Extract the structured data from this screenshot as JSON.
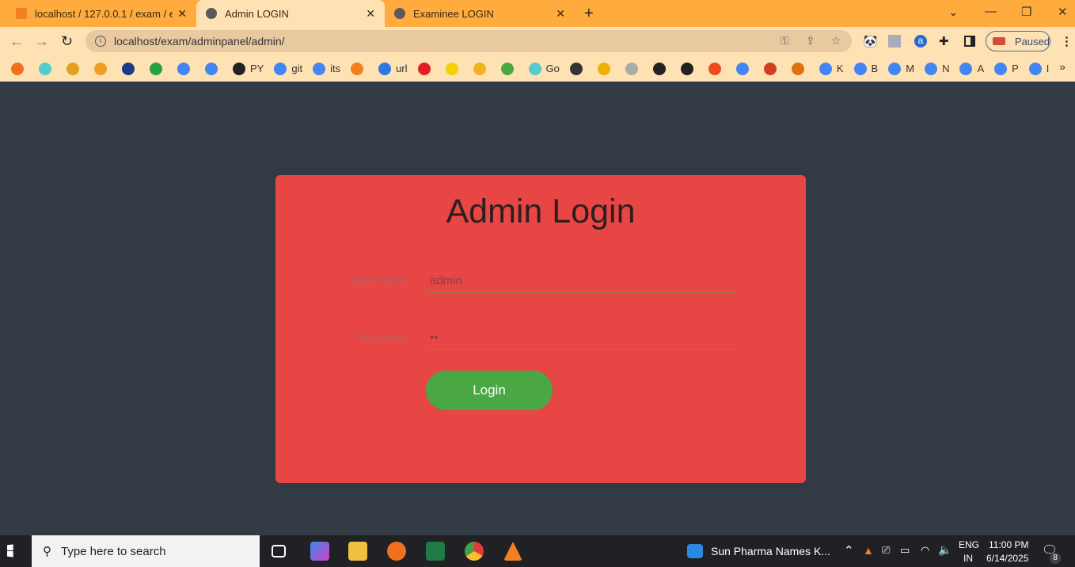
{
  "tabs": [
    {
      "title": "localhost / 127.0.0.1 / exam / exa",
      "icon": "phpmyadmin-icon",
      "active": false
    },
    {
      "title": "Admin LOGIN",
      "icon": "globe-icon",
      "active": true
    },
    {
      "title": "Examinee LOGIN",
      "icon": "globe-icon",
      "active": false
    }
  ],
  "address": "localhost/exam/adminpanel/admin/",
  "profile": {
    "label": "Paused"
  },
  "bookmarks": [
    {
      "label": "",
      "c": "#f07020"
    },
    {
      "label": "",
      "c": "#5cc"
    },
    {
      "label": "",
      "c": "#e0a020"
    },
    {
      "label": "",
      "c": "#f0a020"
    },
    {
      "label": "",
      "c": "#1a3a8a"
    },
    {
      "label": "",
      "c": "#25a244"
    },
    {
      "label": "",
      "c": "#4285f4"
    },
    {
      "label": "",
      "c": "#4285f4"
    },
    {
      "label": "PY",
      "c": "#222"
    },
    {
      "label": "git",
      "c": "#4285f4"
    },
    {
      "label": "its",
      "c": "#4285f4"
    },
    {
      "label": "",
      "c": "#f08020"
    },
    {
      "label": "url",
      "c": "#2a7adf"
    },
    {
      "label": "",
      "c": "#e02020"
    },
    {
      "label": "",
      "c": "#f5d000"
    },
    {
      "label": "",
      "c": "#f5b020"
    },
    {
      "label": "",
      "c": "#4aa844"
    },
    {
      "label": "Go",
      "c": "#5cc"
    },
    {
      "label": "",
      "c": "#333"
    },
    {
      "label": "",
      "c": "#f0b000"
    },
    {
      "label": "",
      "c": "#aaa"
    },
    {
      "label": "",
      "c": "#222"
    },
    {
      "label": "",
      "c": "#222"
    },
    {
      "label": "",
      "c": "#f04a20"
    },
    {
      "label": "",
      "c": "#4285f4"
    },
    {
      "label": "",
      "c": "#d04020"
    },
    {
      "label": "",
      "c": "#e07010"
    },
    {
      "label": "K",
      "c": "#4285f4"
    },
    {
      "label": "B",
      "c": "#4285f4"
    },
    {
      "label": "M",
      "c": "#4285f4"
    },
    {
      "label": "N",
      "c": "#4285f4"
    },
    {
      "label": "A",
      "c": "#4285f4"
    },
    {
      "label": "P",
      "c": "#4285f4"
    },
    {
      "label": "I",
      "c": "#4285f4"
    }
  ],
  "login": {
    "title": "Admin Login",
    "username_label": "Username",
    "username_value": "admin",
    "password_label": "Password",
    "password_value": "••",
    "button": "Login"
  },
  "colors": {
    "card": "#e84545",
    "button": "#4aa844",
    "background": "#323a43",
    "tabbar": "#ffab3d"
  },
  "taskbar": {
    "search_placeholder": "Type here to search",
    "news": "Sun Pharma Names K...",
    "lang1": "ENG",
    "lang2": "IN",
    "time": "11:00 PM",
    "date": "6/14/2025",
    "notifications": "8"
  }
}
